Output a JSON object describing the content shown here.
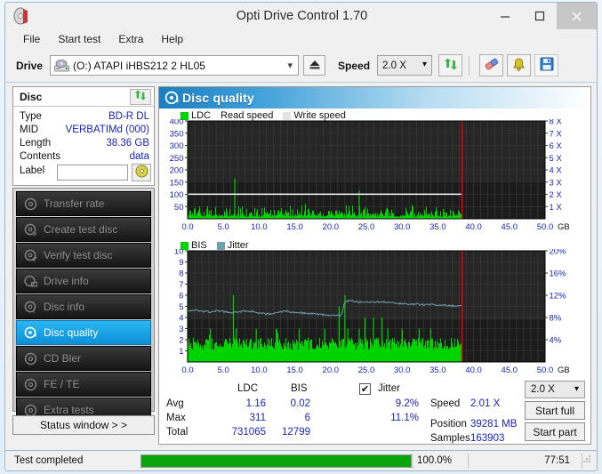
{
  "window": {
    "title": "Opti Drive Control 1.70",
    "app_icon": "disc-icon",
    "minimize": "–",
    "maximize": "☐",
    "close": "✕"
  },
  "menu": {
    "items": [
      "File",
      "Start test",
      "Extra",
      "Help"
    ]
  },
  "toolbar": {
    "drive_label": "Drive",
    "drive_value": "(O:)   ATAPI iHBS212   2 HL05",
    "eject_icon": "eject-icon",
    "speed_label": "Speed",
    "speed_value": "2.0 X",
    "refresh_icon": "refresh-icon",
    "erase_icon": "eraser-icon",
    "bell_icon": "bell-icon",
    "save_icon": "save-icon"
  },
  "disc": {
    "title": "Disc",
    "refresh_icon": "refresh-icon",
    "rows": [
      {
        "key": "Type",
        "value": "BD-R DL"
      },
      {
        "key": "MID",
        "value": "VERBATIMd (000)"
      },
      {
        "key": "Length",
        "value": "38.36 GB"
      },
      {
        "key": "Contents",
        "value": "data"
      }
    ],
    "label_key": "Label",
    "label_value": "",
    "label_placeholder": "",
    "label_button_icon": "cd-icon"
  },
  "sidebar": {
    "items": [
      {
        "label": "Transfer rate",
        "icon": "disc-icon",
        "active": false
      },
      {
        "label": "Create test disc",
        "icon": "disc-write-icon",
        "active": false
      },
      {
        "label": "Verify test disc",
        "icon": "disc-check-icon",
        "active": false
      },
      {
        "label": "Drive info",
        "icon": "drive-icon",
        "active": false
      },
      {
        "label": "Disc info",
        "icon": "disc-info-icon",
        "active": false
      },
      {
        "label": "Disc quality",
        "icon": "disc-quality-icon",
        "active": true
      },
      {
        "label": "CD Bler",
        "icon": "disc-icon",
        "active": false
      },
      {
        "label": "FE / TE",
        "icon": "disc-icon",
        "active": false
      },
      {
        "label": "Extra tests",
        "icon": "disc-icon",
        "active": false
      }
    ],
    "status_window": "Status window > >"
  },
  "panel": {
    "title": "Disc quality",
    "title_icon": "disc-quality-icon"
  },
  "results": {
    "col_ldc": "LDC",
    "col_bis": "BIS",
    "col_jitter": "Jitter",
    "jitter_checked": true,
    "check_glyph": "✔",
    "rows": [
      {
        "label": "Avg",
        "ldc": "1.16",
        "bis": "0.02",
        "jitter": "9.2%"
      },
      {
        "label": "Max",
        "ldc": "311",
        "bis": "6",
        "jitter": "11.1%"
      },
      {
        "label": "Total",
        "ldc": "731065",
        "bis": "12799",
        "jitter": ""
      }
    ],
    "speed_label": "Speed",
    "speed_value": "2.01 X",
    "position_label": "Position",
    "position_value": "39281 MB",
    "samples_label": "Samples",
    "samples_value": "163903",
    "speed_select": "2.0 X",
    "start_full": "Start full",
    "start_part": "Start part"
  },
  "statusbar": {
    "message": "Test completed",
    "progress_percent": 100.0,
    "progress_text": "100.0%",
    "elapsed": "77:51"
  },
  "colors": {
    "ldc_green": "#00d400",
    "bis_green": "#00d400",
    "jitter_teal": "#6f9fb0",
    "read_speed_white": "#ffffff",
    "marker_red": "#e00000",
    "plot_bg": "#1b1b1b",
    "accent_blue": "#1a7fc1",
    "value_blue": "#1b22b8"
  },
  "chart_data": [
    {
      "type": "area",
      "title": "LDC / Read speed / Write speed",
      "legend": [
        "LDC",
        "Read speed",
        "Write speed"
      ],
      "legend_position": "top-left",
      "xlabel": "GB",
      "ylabel": "LDC",
      "y2label": "X",
      "xlim": [
        0,
        50
      ],
      "ylim": [
        0,
        400
      ],
      "y2lim": [
        0,
        8
      ],
      "xticks": [
        0.0,
        5.0,
        10.0,
        15.0,
        20.0,
        25.0,
        30.0,
        35.0,
        40.0,
        45.0,
        50.0
      ],
      "xticklabels": [
        "0.0",
        "5.0",
        "10.0",
        "15.0",
        "20.0",
        "25.0",
        "30.0",
        "35.0",
        "40.0",
        "45.0",
        "50.0"
      ],
      "yticks": [
        50,
        100,
        150,
        200,
        250,
        300,
        350,
        400
      ],
      "y2ticks": [
        1,
        2,
        3,
        4,
        5,
        6,
        7,
        8
      ],
      "y2ticklabels": [
        "1 X",
        "2 X",
        "3 X",
        "4 X",
        "5 X",
        "6 X",
        "7 X",
        "8 X"
      ],
      "grid": true,
      "data_end_gb": 38.4,
      "marker_line_gb": 38.4,
      "read_speed_x": 2.01,
      "series": [
        {
          "name": "LDC",
          "color": "#00d400",
          "x": [
            0.0,
            0.3,
            0.6,
            0.9,
            1.2,
            1.5,
            1.8,
            2.1,
            2.4,
            2.7,
            3.0,
            3.3,
            3.6,
            3.9,
            4.2,
            4.5,
            4.8,
            5.1,
            5.4,
            5.7,
            6.0,
            6.3,
            6.6,
            6.9,
            7.2,
            7.5,
            7.8,
            8.1,
            8.4,
            8.7,
            9.0,
            9.3,
            9.6,
            9.9,
            10.2,
            10.5,
            10.8,
            11.1,
            11.4,
            11.7,
            12.0,
            12.3,
            12.6,
            12.9,
            13.2,
            13.5,
            13.8,
            14.1,
            14.4,
            14.7,
            15.0,
            15.3,
            15.6,
            15.9,
            16.2,
            16.5,
            16.8,
            17.1,
            17.4,
            17.7,
            18.0,
            18.3,
            18.6,
            18.9,
            19.2,
            19.5,
            19.8,
            20.1,
            20.4,
            20.7,
            21.0,
            21.3,
            21.6,
            21.9,
            22.2,
            22.5,
            22.8,
            23.1,
            23.4,
            23.7,
            24.0,
            24.3,
            24.6,
            24.9,
            25.2,
            25.5,
            25.8,
            26.1,
            26.4,
            26.7,
            27.0,
            27.3,
            27.6,
            27.9,
            28.2,
            28.5,
            28.8,
            29.1,
            29.4,
            29.7,
            30.0,
            30.3,
            30.6,
            30.9,
            31.2,
            31.5,
            31.8,
            32.1,
            32.4,
            32.7,
            33.0,
            33.3,
            33.6,
            33.9,
            34.2,
            34.5,
            34.8,
            35.1,
            35.4,
            35.7,
            36.0,
            36.3,
            36.6,
            36.9,
            37.2,
            37.5,
            37.8,
            38.1,
            38.4
          ],
          "y": [
            305,
            40,
            25,
            20,
            45,
            30,
            22,
            60,
            35,
            25,
            75,
            30,
            20,
            40,
            25,
            55,
            30,
            20,
            35,
            25,
            45,
            30,
            165,
            70,
            30,
            45,
            25,
            60,
            35,
            20,
            50,
            25,
            40,
            30,
            55,
            25,
            35,
            45,
            25,
            30,
            40,
            25,
            55,
            30,
            20,
            35,
            25,
            45,
            30,
            60,
            25,
            35,
            20,
            50,
            30,
            25,
            40,
            20,
            35,
            25,
            55,
            30,
            20,
            45,
            25,
            35,
            50,
            25,
            30,
            20,
            40,
            25,
            35,
            55,
            25,
            30,
            45,
            20,
            35,
            25,
            115,
            60,
            30,
            45,
            25,
            35,
            50,
            25,
            30,
            40,
            25,
            35,
            20,
            45,
            25,
            30,
            55,
            25,
            35,
            20,
            40,
            25,
            30,
            45,
            20,
            35,
            25,
            50,
            30,
            20,
            40,
            25,
            35,
            55,
            25,
            30,
            45,
            20,
            35,
            25,
            40,
            30,
            25,
            45,
            20,
            35,
            25,
            30,
            20
          ]
        },
        {
          "name": "Read speed",
          "color": "#ffffff",
          "constant_value_x": 2.01,
          "x_start": 0.0,
          "x_end": 38.4
        },
        {
          "name": "Write speed",
          "color": "#e8e8e8",
          "values": []
        }
      ]
    },
    {
      "type": "area",
      "title": "BIS / Jitter",
      "legend": [
        "BIS",
        "Jitter"
      ],
      "legend_position": "top-left",
      "xlabel": "GB",
      "ylabel": "BIS",
      "y2label": "%",
      "xlim": [
        0,
        50
      ],
      "ylim": [
        0,
        10
      ],
      "y2lim": [
        0,
        20
      ],
      "xticks": [
        0.0,
        5.0,
        10.0,
        15.0,
        20.0,
        25.0,
        30.0,
        35.0,
        40.0,
        45.0,
        50.0
      ],
      "xticklabels": [
        "0.0",
        "5.0",
        "10.0",
        "15.0",
        "20.0",
        "25.0",
        "30.0",
        "35.0",
        "40.0",
        "45.0",
        "50.0"
      ],
      "yticks": [
        1,
        2,
        3,
        4,
        5,
        6,
        7,
        8,
        9,
        10
      ],
      "y2ticks": [
        4,
        8,
        12,
        16,
        20
      ],
      "y2ticklabels": [
        "4%",
        "8%",
        "12%",
        "16%",
        "20%"
      ],
      "grid": true,
      "data_end_gb": 38.4,
      "marker_line_gb": 38.4,
      "series": [
        {
          "name": "BIS",
          "color": "#00d400",
          "baseline": 2,
          "x": [
            0.0,
            0.4,
            0.8,
            1.2,
            1.6,
            2.0,
            2.4,
            2.8,
            3.2,
            3.6,
            4.0,
            4.4,
            4.8,
            5.2,
            5.6,
            6.0,
            6.4,
            6.8,
            7.2,
            7.6,
            8.0,
            8.4,
            8.8,
            9.2,
            9.6,
            10.0,
            10.4,
            10.8,
            11.2,
            11.6,
            12.0,
            12.4,
            12.8,
            13.2,
            13.6,
            14.0,
            14.4,
            14.8,
            15.2,
            15.6,
            16.0,
            16.4,
            16.8,
            17.2,
            17.6,
            18.0,
            18.4,
            18.8,
            19.2,
            19.6,
            20.0,
            20.4,
            20.8,
            21.2,
            21.6,
            22.0,
            22.4,
            22.8,
            23.2,
            23.6,
            24.0,
            24.4,
            24.8,
            25.2,
            25.6,
            26.0,
            26.4,
            26.8,
            27.2,
            27.6,
            28.0,
            28.4,
            28.8,
            29.2,
            29.6,
            30.0,
            30.4,
            30.8,
            31.2,
            31.6,
            32.0,
            32.4,
            32.8,
            33.2,
            33.6,
            34.0,
            34.4,
            34.8,
            35.2,
            35.6,
            36.0,
            36.4,
            36.8,
            37.2,
            37.6,
            38.0,
            38.4
          ],
          "y": [
            6,
            2,
            2,
            1,
            2,
            1,
            2,
            2,
            3,
            2,
            1,
            2,
            2,
            1,
            2,
            2,
            6,
            3,
            2,
            1,
            2,
            2,
            1,
            2,
            3,
            2,
            1,
            2,
            2,
            1,
            2,
            3,
            2,
            1,
            2,
            2,
            1,
            2,
            2,
            3,
            2,
            1,
            2,
            2,
            1,
            2,
            2,
            1,
            3,
            2,
            1,
            2,
            2,
            5,
            2,
            6,
            3,
            2,
            1,
            2,
            3,
            2,
            4,
            1,
            2,
            4,
            2,
            1,
            4,
            2,
            3,
            1,
            2,
            2,
            1,
            3,
            2,
            1,
            2,
            2,
            1,
            3,
            2,
            1,
            2,
            3,
            2,
            1,
            2,
            1,
            2,
            1,
            2,
            1,
            2,
            1,
            1
          ]
        },
        {
          "name": "Jitter",
          "color": "#6f9fb0",
          "unit": "%",
          "x": [
            0.0,
            1.0,
            2.0,
            3.0,
            4.0,
            5.0,
            6.0,
            7.0,
            8.0,
            9.0,
            10.0,
            11.0,
            12.0,
            13.0,
            14.0,
            15.0,
            16.0,
            17.0,
            18.0,
            19.0,
            20.0,
            21.0,
            21.5,
            22.0,
            22.5,
            23.0,
            24.0,
            25.0,
            26.0,
            27.0,
            28.0,
            29.0,
            30.0,
            31.0,
            32.0,
            33.0,
            34.0,
            35.0,
            36.0,
            37.0,
            38.0,
            38.4
          ],
          "y": [
            9.2,
            9.3,
            9.1,
            9.0,
            9.2,
            9.1,
            8.9,
            9.0,
            9.2,
            9.1,
            8.8,
            8.6,
            8.7,
            9.0,
            9.1,
            8.9,
            8.8,
            8.7,
            8.6,
            8.5,
            8.4,
            8.3,
            8.6,
            10.8,
            11.0,
            10.9,
            10.8,
            10.8,
            10.7,
            10.8,
            10.7,
            10.6,
            10.5,
            10.4,
            10.4,
            10.3,
            10.3,
            10.2,
            10.2,
            10.1,
            10.1,
            10.1
          ]
        }
      ]
    }
  ]
}
